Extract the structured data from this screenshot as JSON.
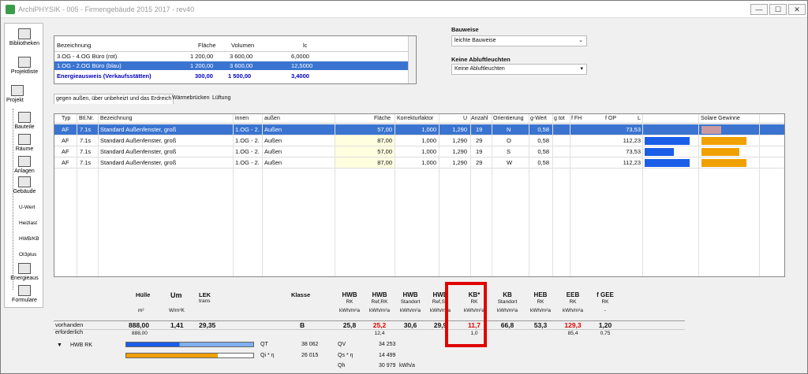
{
  "window": {
    "title": "ArchiPHYSIK - 005 - Firmengebäude 2015 2017 - rev40",
    "minimize": "—",
    "restore": "☐",
    "close": "✕"
  },
  "nav": {
    "bibliothek": "Bibliotheken",
    "projektliste": "Projektliste",
    "projekt": "Projekt",
    "bauteile": "Bauteile",
    "raeume": "Räume",
    "anlagen": "Anlagen",
    "gebaeude": "Gebäude",
    "uwert": "U-Wert",
    "heizlast": "Heizlast",
    "hwbkb": "HWB/KB",
    "oi3": "OI3plus",
    "energieaus": "Energieaus",
    "formulare": "Formulare"
  },
  "zones": {
    "headers": [
      "Bezeichnung",
      "Fläche",
      "Volumen",
      "lc"
    ],
    "rows": [
      [
        "3.OG - 4.OG Büro (rot)",
        "1 200,00",
        "3 600,00",
        "6,0000"
      ],
      [
        "1.OG - 2.OG Büro (blau)",
        "1 200,00",
        "3 600,00",
        "12,5000"
      ],
      [
        "Energieausweis (Verkaufsstätten)",
        "300,00",
        "1 500,00",
        "3,4000"
      ]
    ]
  },
  "bauweise": {
    "label": "Bauweise",
    "value": "leichte Bauweise"
  },
  "abluft": {
    "label": "Keine Abluftleuchten",
    "value": "Keine Abluftleuchten"
  },
  "tabs": [
    "gegen außen, über unbeheizt und das Erdreich",
    "Wärmebrücken",
    "Lüftung"
  ],
  "grid": {
    "headers": [
      "Typ",
      "Btl.Nr.",
      "Bezeichnung",
      "innen",
      "außen",
      "Fläche",
      "Korrekturfaktor",
      "U",
      "Anzahl",
      "Orientierung",
      "g-Wert",
      "g tot",
      "f FH",
      "f OP",
      "L",
      "Solare Gewinne"
    ],
    "rows": [
      [
        "AF",
        "7.1s",
        "Standard Außenfenster, groß",
        "1.OG - 2.",
        "Außen",
        "57,00",
        "1,000",
        "1,290",
        "19",
        "N",
        "0,58",
        "73,53"
      ],
      [
        "AF",
        "7.1s",
        "Standard Außenfenster, groß",
        "1.OG - 2.",
        "Außen",
        "87,00",
        "1,000",
        "1,290",
        "29",
        "O",
        "0,58",
        "112,23"
      ],
      [
        "AF",
        "7.1s",
        "Standard Außenfenster, groß",
        "1.OG - 2.",
        "Außen",
        "57,00",
        "1,000",
        "1,290",
        "19",
        "S",
        "0,58",
        "73,53"
      ],
      [
        "AF",
        "7.1s",
        "Standard Außenfenster, groß",
        "1.OG - 2.",
        "Außen",
        "87,00",
        "1,000",
        "1,290",
        "29",
        "W",
        "0,58",
        "112,23"
      ]
    ],
    "L_fill": [
      0,
      0.95,
      0.62,
      0.95
    ],
    "solar_fill": [
      0.42,
      0.95,
      0.8,
      0.95
    ],
    "colors": {
      "blue": "#1a5ee8",
      "orange": "#f0a000",
      "pink": "#c89aa0"
    }
  },
  "summary": {
    "huelle": "Hülle",
    "um": "Um",
    "lek": "LEK",
    "lek_sub": "trans",
    "klasse": "Klasse",
    "units": [
      "m²",
      "W/m²K"
    ],
    "cols": [
      {
        "h": "HWB",
        "s1": "RK",
        "s2": "kWh/m²a"
      },
      {
        "h": "HWB",
        "s1": "Ref,RK",
        "s2": "kWh/m²a"
      },
      {
        "h": "HWB",
        "s1": "Standort",
        "s2": "kWh/m²a"
      },
      {
        "h": "HWB",
        "s1": "Ref,SK",
        "s2": "kWh/m²a"
      },
      {
        "h": "KB*",
        "s1": "RK",
        "s2": "kWh/m²a"
      },
      {
        "h": "KB",
        "s1": "Standort",
        "s2": "kWh/m²a"
      },
      {
        "h": "HEB",
        "s1": "RK",
        "s2": "kWh/m²a"
      },
      {
        "h": "EEB",
        "s1": "RK",
        "s2": "kWh/m²a"
      },
      {
        "h": "f GEE",
        "s1": "RK",
        "s2": "-"
      }
    ],
    "vorhanden": "vorhanden",
    "erforderlich": "erforderlich",
    "v": {
      "flaeche": "888,00",
      "um": "1,41",
      "lek": "29,35",
      "klasse": "B",
      "hwb_rk": "25,8",
      "hwb_refrk": "25,2",
      "hwb_st": "30,6",
      "hwb_refsk": "29,9",
      "kb_rk": "11,7",
      "kb_st": "66,8",
      "heb": "53,3",
      "eeb": "129,3",
      "fgee": "1,20"
    },
    "e": {
      "flaeche": "888,00",
      "hwb_refrk": "12,4",
      "kb_rk": "1,0",
      "eeb": "85,4",
      "fgee": "0,75"
    },
    "hwbrk": "HWB RK",
    "qt": "QT",
    "qt_v": "38 062",
    "qv": "QV",
    "qv_v": "34 253",
    "qi": "Qi * η",
    "qi_v": "26 015",
    "qs": "Qs * η",
    "qs_v": "14 499",
    "qh": "Qh",
    "qh_v": "30 979",
    "qh_u": "kWh/a"
  }
}
